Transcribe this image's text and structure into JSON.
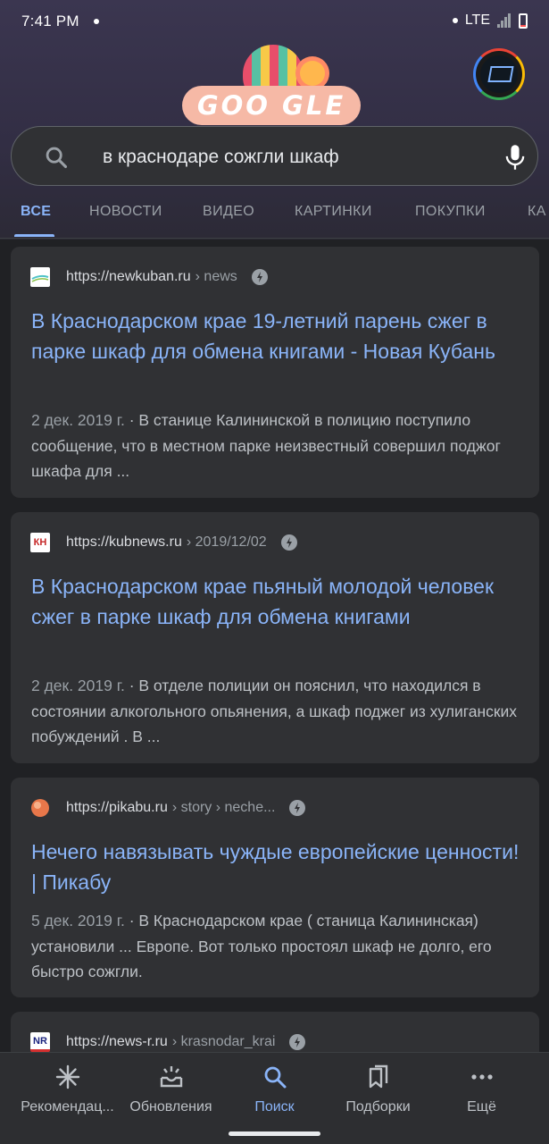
{
  "status_bar": {
    "time": "7:41 PM",
    "network": "LTE"
  },
  "doodle": {
    "text": "GOO GLE"
  },
  "search": {
    "query": "в краснодаре сожгли шкаф"
  },
  "tabs": [
    {
      "label": "ВСЕ",
      "active": true
    },
    {
      "label": "НОВОСТИ"
    },
    {
      "label": "ВИДЕО"
    },
    {
      "label": "КАРТИНКИ"
    },
    {
      "label": "ПОКУПКИ"
    },
    {
      "label": "КА"
    }
  ],
  "results": [
    {
      "site": "https://newkuban.ru",
      "path": "› news",
      "title": "В Краснодарском крае 19-летний парень сжег в парке шкаф для обмена книгами - Новая Кубань",
      "date": "2 дек. 2019 г.",
      "snippet": " · В станице Калининской в полицию поступило сообщение, что в местном парке неизвестный совершил поджог шкафа для ...",
      "favicon_color": "#4fc3c7"
    },
    {
      "site": "https://kubnews.ru",
      "path": "› 2019/12/02",
      "title": "В Краснодарском крае пьяный молодой человек сжег в парке шкаф для обмена книгами",
      "date": "2 дек. 2019 г.",
      "snippet": " · В отделе полиции он пояснил, что находился в состоянии алкогольного опьянения, а шкаф поджег из хулиганских побуждений . В ...",
      "favicon_text": "КН"
    },
    {
      "site": "https://pikabu.ru",
      "path": "› story › neche...",
      "title": "Нечего навязывать чуждые европейские ценности! | Пикабу",
      "date": "5 дек. 2019 г.",
      "snippet": " · В Краснодарском крае ( станица Калининская) установили ... Европе. Вот только простоял шкаф не долго, его быстро сожгли.",
      "favicon_color": "#e8774a"
    },
    {
      "site": "https://news-r.ru",
      "path": "› krasnodar_krai",
      "favicon_text": "NR"
    }
  ],
  "bottom_nav": [
    {
      "label": "Рекомендац...",
      "icon": "sparkle-icon"
    },
    {
      "label": "Обновления",
      "icon": "updates-icon"
    },
    {
      "label": "Поиск",
      "icon": "search-icon",
      "active": true
    },
    {
      "label": "Подборки",
      "icon": "collections-icon"
    },
    {
      "label": "Ещё",
      "icon": "more-icon"
    }
  ],
  "colors": {
    "link": "#8ab4f8",
    "background": "#202124",
    "card": "#303134"
  }
}
